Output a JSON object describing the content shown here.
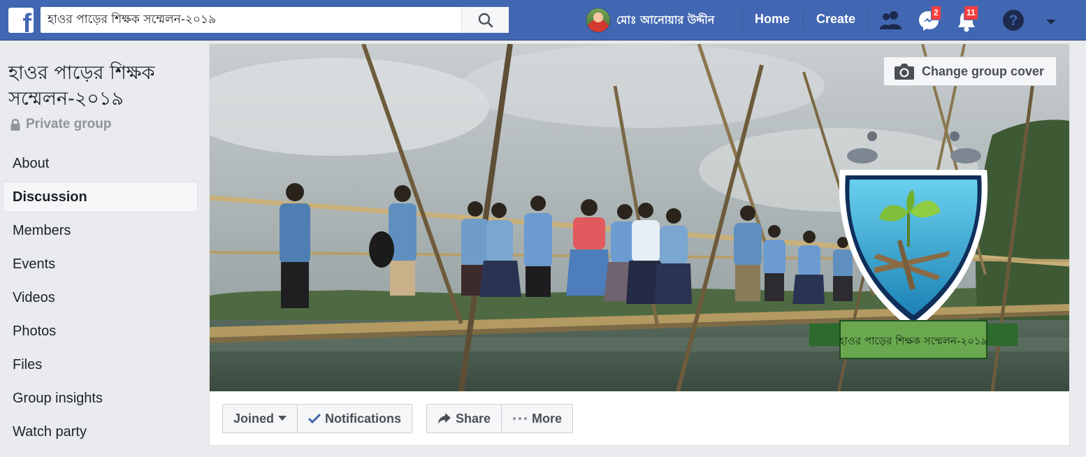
{
  "topbar": {
    "search_value": "হাওর পাড়ের শিক্ষক সম্মেলন-২০১৯",
    "user_name": "মোঃ আনোয়ার উদ্দীন",
    "home": "Home",
    "create": "Create",
    "messages_count": "2",
    "notifications_count": "11"
  },
  "group": {
    "title": "হাওর পাড়ের শিক্ষক সম্মেলন-২০১৯",
    "privacy": "Private group"
  },
  "sidebar": {
    "items": [
      {
        "label": "About"
      },
      {
        "label": "Discussion"
      },
      {
        "label": "Members"
      },
      {
        "label": "Events"
      },
      {
        "label": "Videos"
      },
      {
        "label": "Photos"
      },
      {
        "label": "Files"
      },
      {
        "label": "Group insights"
      },
      {
        "label": "Watch party"
      }
    ]
  },
  "cover": {
    "change_label": "Change group cover",
    "banner_text": "হাওর পাড়ের শিক্ষক সম্মেলন-২০১৯"
  },
  "actions": {
    "joined": "Joined",
    "notifications": "Notifications",
    "share": "Share",
    "more": "More"
  },
  "colors": {
    "brand": "#4267b2",
    "badge": "#fa3e3e",
    "background": "#e9ebee"
  }
}
